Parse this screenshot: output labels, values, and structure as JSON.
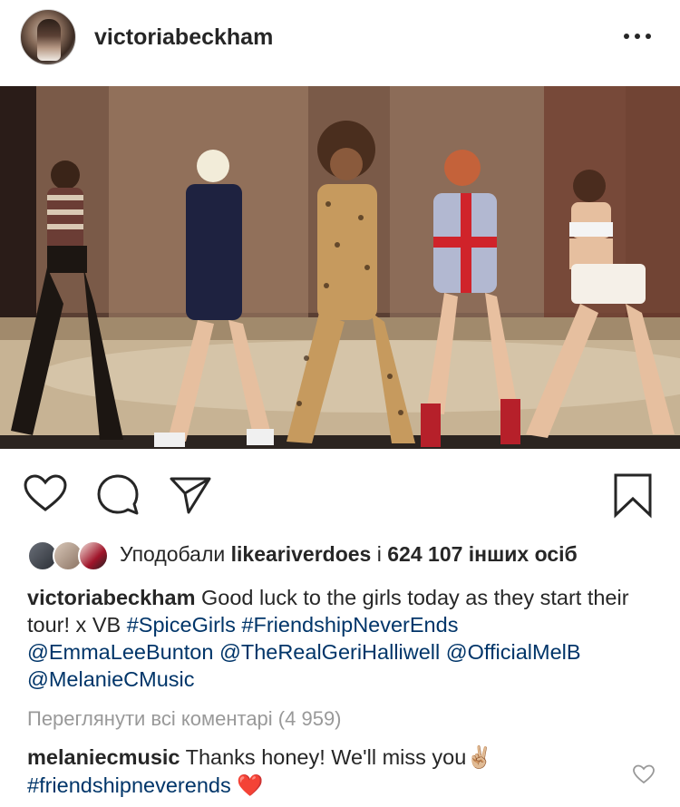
{
  "post": {
    "username": "victoriabeckham",
    "image_alt": "Spice Girls performing on stage"
  },
  "likes": {
    "prefix": "Уподобали",
    "user": "likeariverdoes",
    "connector": "і",
    "count_text": "624 107 інших осіб"
  },
  "caption": {
    "username": "victoriabeckham",
    "text": " Good luck to the girls today as they start their tour! x VB ",
    "hashtags": [
      "#SpiceGirls",
      "#FriendshipNeverEnds"
    ],
    "mentions": [
      "@EmmaLeeBunton",
      "@TheRealGeriHalliwell",
      "@OfficialMelB",
      "@MelanieCMusic"
    ]
  },
  "view_all_comments": "Переглянути всі коментарі (4 959)",
  "comment": {
    "username": "melaniecmusic",
    "text": " Thanks honey! We'll miss you",
    "emoji1": "✌🏼",
    "hashtag": "#friendshipneverends",
    "emoji2": "❤️"
  },
  "icons": {
    "more": "more-options-icon",
    "like": "heart-icon",
    "comment": "comment-icon",
    "share": "send-icon",
    "save": "bookmark-icon"
  },
  "colors": {
    "link": "#003569",
    "muted": "#999999",
    "text": "#262626"
  }
}
